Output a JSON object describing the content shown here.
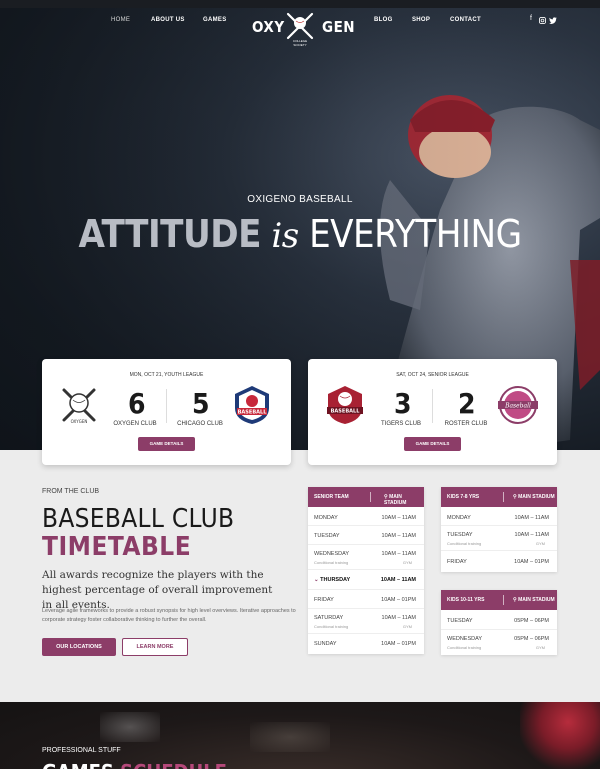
{
  "nav": {
    "left": [
      "HOME",
      "ABOUT US",
      "GAMES"
    ],
    "right": [
      "BLOG",
      "SHOP",
      "CONTACT"
    ],
    "logo_left": "OXY",
    "logo_right": "GEN",
    "logo_sub": "COLLEGE SOCIETY",
    "social": [
      "facebook-icon",
      "instagram-icon",
      "twitter-icon"
    ]
  },
  "hero": {
    "kicker": "OXIGENO BASEBALL",
    "title_a": "ATTITUDE",
    "title_b": "is",
    "title_c": "EVERYTHING"
  },
  "games": [
    {
      "date": "MON, OCT 21, YOUTH LEAGUE",
      "home_team": "OXYGEN CLUB",
      "home_score": "6",
      "away_team": "CHICAGO CLUB",
      "away_score": "5",
      "button": "GAME DETAILS",
      "home_badge": "OXYGEN",
      "away_badge": "BASEBALL"
    },
    {
      "date": "SAT, OCT 24, SENIOR LEAGUE",
      "home_team": "TIGERS CLUB",
      "home_score": "3",
      "away_team": "ROSTER CLUB",
      "away_score": "2",
      "button": "GAME DETAILS",
      "home_badge": "BASEBALL",
      "away_badge": "Baseball"
    }
  ],
  "timetable": {
    "kicker": "FROM THE CLUB",
    "title1": "BASEBALL CLUB",
    "title2": "TIMETABLE",
    "lead": "All awards recognize the players with the highest percentage of overall improvement in all events.",
    "body": "Leverage agile frameworks to provide a robust synopsis for high level overviews. Iterative approaches to corporate strategy foster collaborative thinking to further the overall.",
    "btn_locations": "OUR LOCATIONS",
    "btn_more": "LEARN MORE"
  },
  "schedules": {
    "senior": {
      "team": "SENIOR TEAM",
      "venue": "MAIN STADIUM",
      "rows": [
        {
          "day": "MONDAY",
          "time": "10AM – 11AM",
          "note": "",
          "gym": ""
        },
        {
          "day": "TUESDAY",
          "time": "10AM – 11AM",
          "note": "",
          "gym": ""
        },
        {
          "day": "WEDNESDAY",
          "time": "10AM – 11AM",
          "note": "Conditional training",
          "gym": "GYM"
        },
        {
          "day": "THURSDAY",
          "time": "10AM – 11AM",
          "note": "",
          "gym": ""
        },
        {
          "day": "FRIDAY",
          "time": "10AM – 01PM",
          "note": "",
          "gym": ""
        },
        {
          "day": "SATURDAY",
          "time": "10AM – 11AM",
          "note": "Conditional training",
          "gym": "GYM"
        },
        {
          "day": "SUNDAY",
          "time": "10AM – 01PM",
          "note": "",
          "gym": ""
        }
      ]
    },
    "kids78": {
      "team": "KIDS 7-8 YRS",
      "venue": "MAIN STADIUM",
      "rows": [
        {
          "day": "MONDAY",
          "time": "10AM – 11AM",
          "note": "",
          "gym": ""
        },
        {
          "day": "TUESDAY",
          "time": "10AM – 11AM",
          "note": "Conditional training",
          "gym": "GYM"
        },
        {
          "day": "FRIDAY",
          "time": "10AM – 01PM",
          "note": "",
          "gym": ""
        }
      ]
    },
    "kids1011": {
      "team": "KIDS 10-11 YRS",
      "venue": "MAIN STADIUM",
      "rows": [
        {
          "day": "TUESDAY",
          "time": "05PM – 06PM",
          "note": "",
          "gym": ""
        },
        {
          "day": "WEDNESDAY",
          "time": "05PM – 06PM",
          "note": "Conditional training",
          "gym": "GYM"
        }
      ]
    }
  },
  "bottom": {
    "kicker": "PROFESSIONAL STUFF",
    "title_a": "GAMES",
    "title_b": "SCHEDULE"
  },
  "colors": {
    "accent": "#8c3d68",
    "dark": "#161c24"
  }
}
